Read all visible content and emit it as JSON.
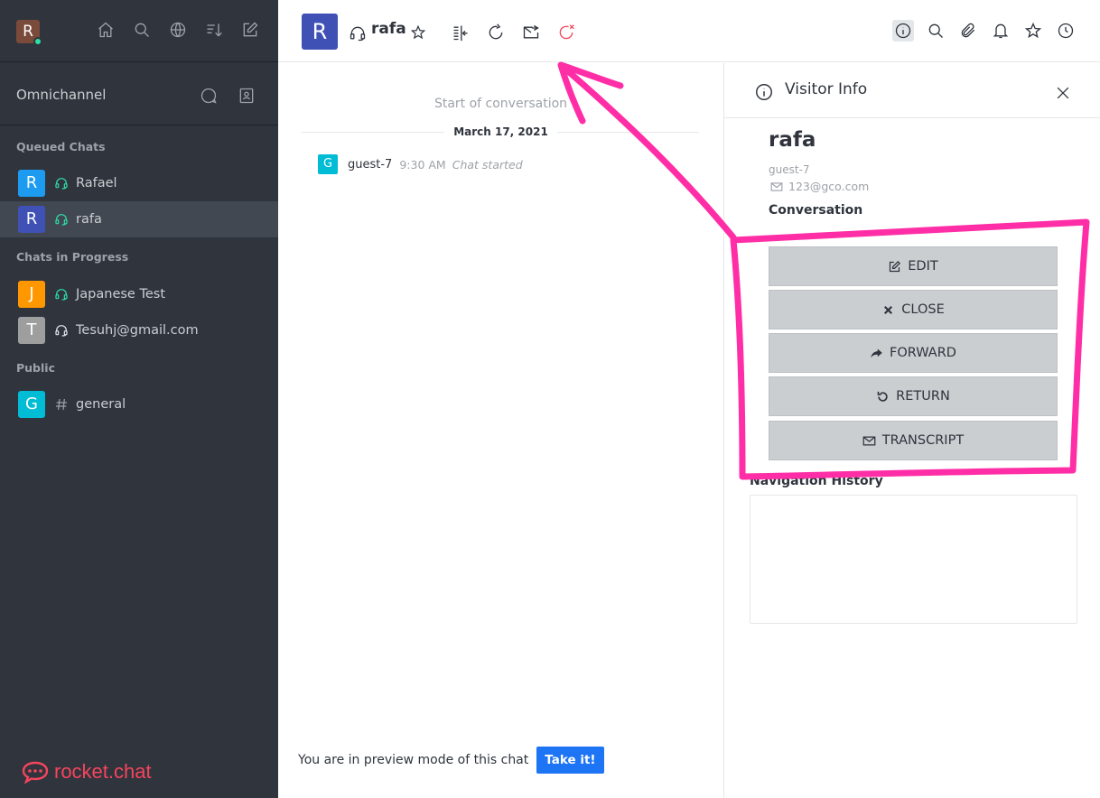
{
  "user": {
    "avatar_letter": "R",
    "avatar_color": "#7a4a3a",
    "status_color": "#2de0a5"
  },
  "sidebar": {
    "section_title": "Omnichannel",
    "groups": [
      {
        "title": "Queued Chats"
      },
      {
        "title": "Chats in Progress"
      },
      {
        "title": "Public"
      }
    ],
    "rooms": [
      {
        "letter": "R",
        "name": "Rafael",
        "color": "#1d9bf0",
        "icon": "headset-icon"
      },
      {
        "letter": "R",
        "name": "rafa",
        "color": "#3f51b5",
        "icon": "headset-icon"
      },
      {
        "letter": "J",
        "name": "Japanese Test",
        "color": "#ff9800",
        "icon": "headset-icon"
      },
      {
        "letter": "T",
        "name": "Tesuhj@gmail.com",
        "color": "#9e9e9e",
        "icon": "headset-icon"
      },
      {
        "letter": "G",
        "name": "general",
        "color": "#00bcd4",
        "icon": "hash-icon"
      }
    ],
    "logo_text": "rocket.chat"
  },
  "header": {
    "avatar_letter": "R",
    "avatar_color": "#3f51b5",
    "title": "rafa"
  },
  "chat": {
    "start_label": "Start of conversation",
    "date": "March 17, 2021",
    "message": {
      "avatar_letter": "G",
      "user": "guest-7",
      "time": "9:30 AM",
      "text": "Chat started"
    },
    "preview_text": "You are in preview mode of this chat",
    "take_label": "Take it!"
  },
  "panel": {
    "title": "Visitor Info",
    "visitor_name": "rafa",
    "visitor_username": "guest-7",
    "visitor_email": "123@gco.com",
    "conversation_label": "Conversation",
    "buttons": {
      "edit": "EDIT",
      "close": "CLOSE",
      "forward": "FORWARD",
      "return": "RETURN",
      "transcript": "TRANSCRIPT"
    },
    "nav_history_label": "Navigation History"
  },
  "colors": {
    "accent": "#1d74f5",
    "annotation": "#ff2ea6",
    "close_chat_icon": "#f5455c"
  }
}
